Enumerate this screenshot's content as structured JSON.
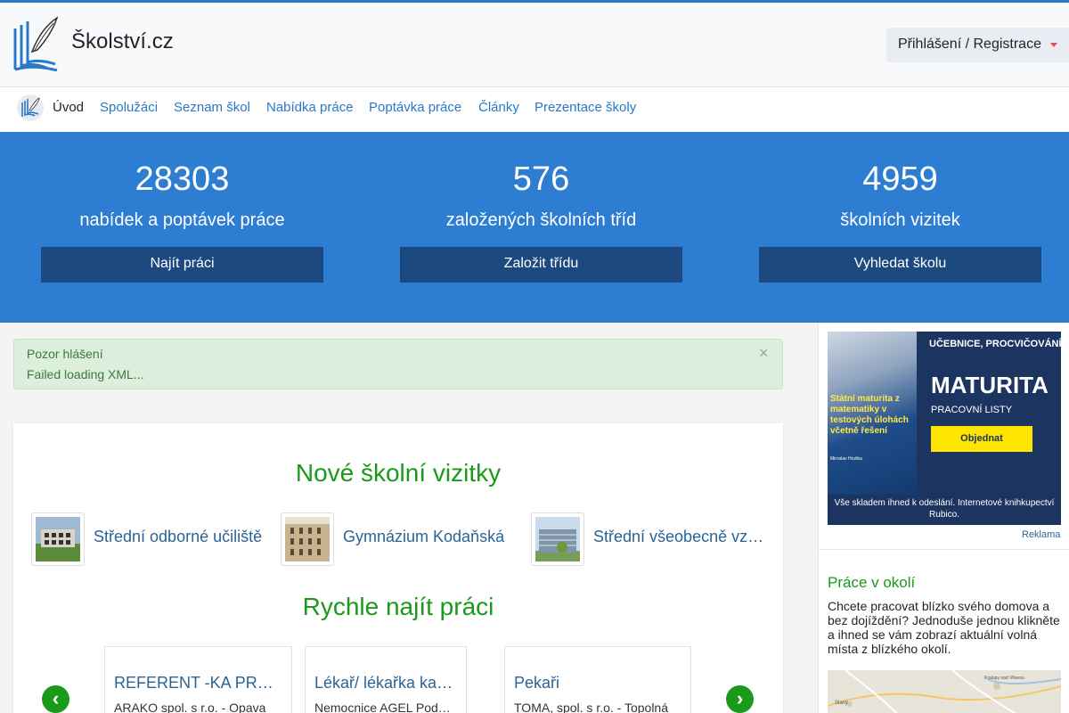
{
  "colors": {
    "accent": "#2a78c8",
    "stats_band": "#2d7dd2",
    "stats_button": "#1c4a80",
    "section_title": "#1a9a1a",
    "alert_bg": "#dcefdc",
    "link": "#2a6496"
  },
  "header": {
    "brand": "Školství.cz",
    "logo_icon": "book-feather-logo",
    "login_label": "Přihlášení / Registrace"
  },
  "nav": {
    "home_icon": "book-feather-logo",
    "items": [
      {
        "label": "Úvod",
        "active": true
      },
      {
        "label": "Spolužáci",
        "active": false
      },
      {
        "label": "Seznam škol",
        "active": false
      },
      {
        "label": "Nabídka práce",
        "active": false
      },
      {
        "label": "Poptávka práce",
        "active": false
      },
      {
        "label": "Články",
        "active": false
      },
      {
        "label": "Prezentace školy",
        "active": false
      }
    ]
  },
  "stats": [
    {
      "value": "28303",
      "label": "nabídek a poptávek práce",
      "button": "Najít práci"
    },
    {
      "value": "576",
      "label": "založených školních tříd",
      "button": "Založit třídu"
    },
    {
      "value": "4959",
      "label": "školních vizitek",
      "button": "Vyhledat školu"
    }
  ],
  "alert": {
    "title": "Pozor hlášení",
    "message": "Failed loading XML...",
    "close": "×"
  },
  "schools": {
    "title": "Nové školní vizitky",
    "items": [
      {
        "name": "Střední odborné učiliště"
      },
      {
        "name": "Gymnázium Kodaňská"
      },
      {
        "name": "Střední všeobecně vzdělávací"
      }
    ]
  },
  "jobs": {
    "title": "Rychle najít práci",
    "prev": "‹",
    "next": "›",
    "items": [
      {
        "title": "REFERENT -KA PRODEJE",
        "company": "ARAKO spol. s r.o. - Opava"
      },
      {
        "title": "Lékař/ lékařka kardiologie",
        "company": "Nemocnice AGEL Podhorská"
      },
      {
        "title": "Pekaři",
        "company": "TOMA, spol. s r.o. - Topolná"
      }
    ]
  },
  "sidebar": {
    "ad": {
      "top": "UČEBNICE, PROCVIČOVÁNÍ",
      "main": "MATURITA",
      "sub": "PRACOVNÍ LISTY",
      "cta": "Objednat",
      "left_text": "Státní maturita z matematiky v testových úlohách včetně řešení",
      "left_author": "Miroslav Hruška",
      "bottom": "Vše skladem ihned k odeslání. Internetové knihkupectví Rubico."
    },
    "ad_label": "Reklama",
    "title": "Práce v okolí",
    "text": "Chcete pracovat blízko svého domova a bez dojíždění? Jednoduše jednou klikněte a ihned se vám zobrazí aktuální volná místa z blízkého okolí.",
    "map_labels": [
      "Slaný",
      "Kralupy nad Vltavou"
    ]
  }
}
